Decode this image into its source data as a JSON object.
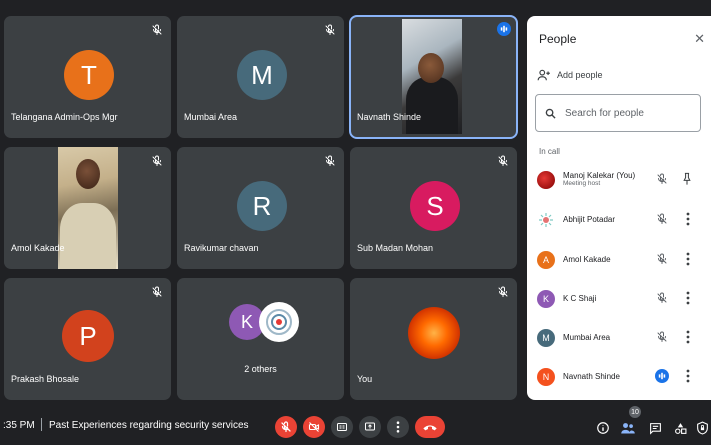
{
  "tiles": [
    {
      "name": "Telangana Admin-Ops Mgr",
      "initial": "T",
      "color": "#e8711a"
    },
    {
      "name": "Mumbai Area",
      "initial": "M",
      "color": "#476a7b"
    },
    {
      "name": "Navnath Shinde"
    },
    {
      "name": "Amol Kakade"
    },
    {
      "name": "Ravikumar chavan",
      "initial": "R",
      "color": "#476a7b"
    },
    {
      "name": "Sub Madan Mohan",
      "initial": "S",
      "color": "#d81b60"
    },
    {
      "name": "Prakash Bhosale",
      "initial": "P",
      "color": "#d2421d"
    },
    {
      "name": "2 others",
      "initial": "K",
      "color": "#8e59b4"
    },
    {
      "name": "You"
    }
  ],
  "panel": {
    "title": "People",
    "add_people": "Add people",
    "search_placeholder": "Search for people",
    "in_call": "In call",
    "people": [
      {
        "name": "Manoj Kalekar (You)",
        "sub": "Meeting host",
        "initial": "",
        "color": "#c62828"
      },
      {
        "name": "Abhijit Potadar",
        "initial": "",
        "color": "#ffffff"
      },
      {
        "name": "Amol Kakade",
        "initial": "A",
        "color": "#e8711a"
      },
      {
        "name": "K C Shaji",
        "initial": "K",
        "color": "#8e59b4"
      },
      {
        "name": "Mumbai Area",
        "initial": "M",
        "color": "#476a7b"
      },
      {
        "name": "Navnath Shinde",
        "initial": "N",
        "color": "#f4511e"
      }
    ]
  },
  "bottom": {
    "time": ":35 PM",
    "meeting_title": "Past Experiences regarding security services",
    "participants_count": "10"
  },
  "colors": {
    "accent": "#1a73e8",
    "danger": "#ea4335"
  }
}
